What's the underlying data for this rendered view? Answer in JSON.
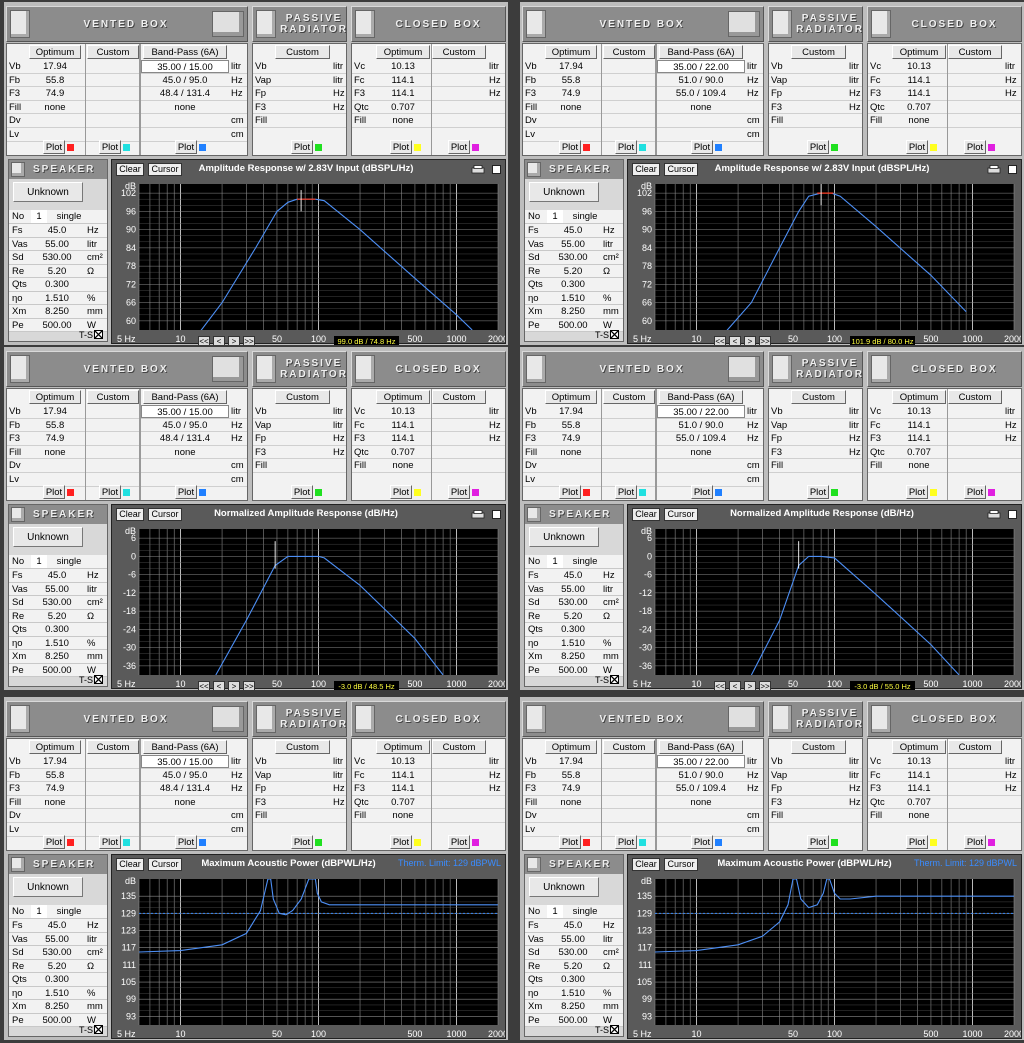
{
  "colors": {
    "curve": "#4d8ff5",
    "peak": "#ff3a1a",
    "therm": "#3a8cff",
    "readout": "#ffff40"
  },
  "headers": {
    "vented": "VENTED BOX",
    "passive": "PASSIVE RADIATOR",
    "closed": "CLOSED BOX",
    "speaker": "SPEAKER"
  },
  "tabs": {
    "optimum": "Optimum",
    "custom": "Custom",
    "bandpass": "Band-Pass (6A)",
    "custom_pr": "Custom",
    "optimum_cb": "Optimum",
    "custom_cb": "Custom",
    "plot": "Plot"
  },
  "chart_buttons": {
    "clear": "Clear",
    "cursor": "Cursor",
    "ts": "T-S",
    "nav": [
      "<<",
      "<",
      ">",
      ">>"
    ]
  },
  "vented": {
    "labels": [
      "Vb",
      "Fb",
      "F3",
      "Fill",
      "Dv",
      "Lv"
    ],
    "optimum": [
      "17.94",
      "55.8",
      "74.9",
      "none",
      "",
      ""
    ],
    "units": [
      "litr",
      "Hz",
      "Hz",
      "",
      "cm",
      "cm"
    ]
  },
  "passive": {
    "labels": [
      "Vb",
      "Vap",
      "Fp",
      "F3",
      "Fill"
    ],
    "units": [
      "litr",
      "litr",
      "Hz",
      "Hz",
      ""
    ]
  },
  "closed": {
    "labels": [
      "Vc",
      "Fc",
      "F3",
      "Qtc",
      "Fill"
    ],
    "optimum": [
      "10.13",
      "114.1",
      "114.1",
      "0.707",
      "none"
    ],
    "units": [
      "litr",
      "Hz",
      "Hz",
      "",
      ""
    ]
  },
  "speaker": {
    "name": "Unknown",
    "no_label": "No",
    "no_value": "1",
    "mode": "single",
    "labels": [
      "Fs",
      "Vas",
      "Sd",
      "Re",
      "Qts",
      "ηo",
      "Xm",
      "Pe"
    ],
    "values": [
      "45.0",
      "55.00",
      "530.00",
      "5.20",
      "0.300",
      "1.510",
      "8.250",
      "500.00"
    ],
    "units": [
      "Hz",
      "litr",
      "cm²",
      "Ω",
      "",
      "%",
      "mm",
      "W"
    ]
  },
  "bandpass_left": {
    "values": [
      "35.00 / 15.00",
      "45.0 / 95.0",
      "48.4 / 131.4",
      "none"
    ],
    "units": [
      "litr",
      "Hz",
      "Hz",
      ""
    ]
  },
  "bandpass_right": {
    "values": [
      "35.00 / 22.00",
      "51.0 / 90.0",
      "55.0 / 109.4",
      "none"
    ],
    "units": [
      "litr",
      "Hz",
      "Hz",
      ""
    ]
  },
  "x_ticks": [
    "5 Hz",
    "10",
    "50",
    "100",
    "500",
    "1000",
    "2000"
  ],
  "charts": {
    "amp_left": {
      "title": "Amplitude Response w/ 2.83V Input (dBSPL/Hz)",
      "readout": "99.0 dB / 74.8 Hz"
    },
    "amp_right": {
      "title": "Amplitude Response w/ 2.83V Input (dBSPL/Hz)",
      "readout": "101.9 dB / 80.0 Hz"
    },
    "norm_left": {
      "title": "Normalized Amplitude Response (dB/Hz)",
      "readout": "-3.0 dB / 48.5 Hz"
    },
    "norm_right": {
      "title": "Normalized Amplitude Response (dB/Hz)",
      "readout": "-3.0 dB / 55.0 Hz"
    },
    "pow_left": {
      "title": "Maximum Acoustic Power (dBPWL/Hz)",
      "therm": "Therm. Limit: 129 dBPWL"
    },
    "pow_right": {
      "title": "Maximum Acoustic Power (dBPWL/Hz)",
      "therm": "Therm. Limit: 129 dBPWL"
    }
  },
  "chart_data": [
    {
      "type": "line",
      "title": "Amplitude Response w/ 2.83V Input (dBSPL/Hz)",
      "ylabel": "dB",
      "xlim": [
        5,
        2000
      ],
      "ylim": [
        57,
        105
      ],
      "yticks": [
        "dB",
        "102",
        "96",
        "90",
        "84",
        "78",
        "72",
        "66",
        "60"
      ],
      "x": [
        5,
        20,
        35,
        50,
        60,
        70,
        80,
        95,
        110,
        200,
        500,
        1000,
        1300
      ],
      "y": [
        30,
        66,
        84,
        96,
        99,
        100,
        100,
        100,
        99.5,
        90,
        74,
        62,
        57
      ]
    },
    {
      "type": "line",
      "title": "Amplitude Response w/ 2.83V Input (dBSPL/Hz)",
      "ylabel": "dB",
      "xlim": [
        5,
        2000
      ],
      "ylim": [
        57,
        105
      ],
      "yticks": [
        "dB",
        "102",
        "96",
        "90",
        "84",
        "78",
        "72",
        "66",
        "60"
      ],
      "x": [
        5,
        25,
        40,
        55,
        65,
        80,
        95,
        110,
        200,
        500,
        900
      ],
      "y": [
        30,
        66,
        84,
        96,
        101,
        102,
        102,
        101,
        91,
        75,
        63
      ]
    },
    {
      "type": "line",
      "title": "Normalized Amplitude Response (dB/Hz)",
      "ylabel": "dB",
      "xlim": [
        5,
        2000
      ],
      "ylim": [
        -39,
        9
      ],
      "yticks": [
        "dB",
        "6",
        "0",
        "-6",
        "-12",
        "-18",
        "-24",
        "-30",
        "-36"
      ],
      "x": [
        18,
        30,
        48.5,
        60,
        70,
        100,
        110,
        200,
        500,
        800
      ],
      "y": [
        -39,
        -21,
        -3,
        0,
        0,
        0,
        -0.5,
        -9.5,
        -27,
        -39
      ]
    },
    {
      "type": "line",
      "title": "Normalized Amplitude Response (dB/Hz)",
      "ylabel": "dB",
      "xlim": [
        5,
        2000
      ],
      "ylim": [
        -39,
        9
      ],
      "yticks": [
        "dB",
        "6",
        "0",
        "-6",
        "-12",
        "-18",
        "-24",
        "-30",
        "-36"
      ],
      "x": [
        25,
        40,
        55,
        65,
        80,
        100,
        200,
        500,
        800
      ],
      "y": [
        -39,
        -21,
        -3,
        0,
        0,
        -0.5,
        -12.5,
        -29,
        -39
      ]
    },
    {
      "type": "line",
      "title": "Maximum Acoustic Power (dBPWL/Hz)",
      "ylabel": "dB",
      "xlim": [
        5,
        2000
      ],
      "ylim": [
        90,
        141
      ],
      "yticks": [
        "dB",
        "135",
        "129",
        "123",
        "117",
        "111",
        "105",
        "99",
        "93"
      ],
      "limit": 129,
      "x": [
        5,
        10,
        20,
        30,
        38,
        43,
        45,
        47,
        52,
        58,
        65,
        75,
        85,
        92,
        95,
        98,
        105,
        120,
        150,
        300,
        1000,
        2000
      ],
      "y": [
        115.5,
        116,
        118,
        122,
        130,
        141,
        141,
        134,
        129,
        128.5,
        130,
        134,
        141,
        141,
        141,
        136,
        133,
        132,
        132,
        132,
        132,
        132
      ]
    },
    {
      "type": "line",
      "title": "Maximum Acoustic Power (dBPWL/Hz)",
      "ylabel": "dB",
      "xlim": [
        5,
        2000
      ],
      "ylim": [
        90,
        141
      ],
      "yticks": [
        "dB",
        "135",
        "129",
        "123",
        "117",
        "111",
        "105",
        "99",
        "93"
      ],
      "limit": 129,
      "x": [
        5,
        10,
        20,
        30,
        40,
        46,
        50,
        53,
        57,
        65,
        75,
        83,
        88,
        92,
        100,
        110,
        130,
        200,
        500,
        2000
      ],
      "y": [
        115.5,
        116,
        118,
        121,
        126,
        132,
        141,
        141,
        134,
        131,
        132,
        136,
        141,
        141,
        136,
        134,
        134,
        135,
        135,
        135
      ]
    }
  ]
}
